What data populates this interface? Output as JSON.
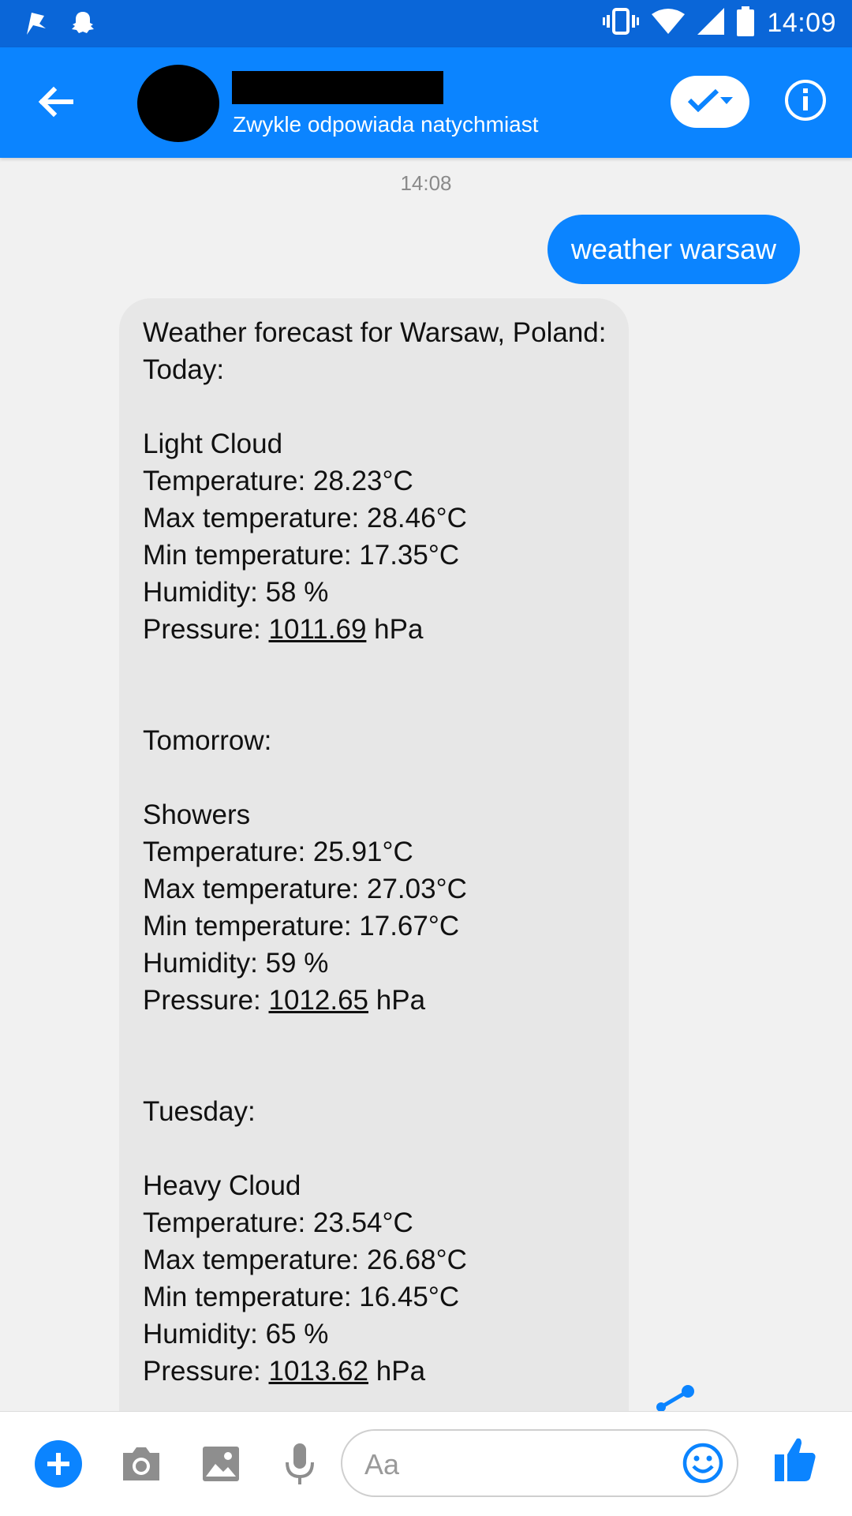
{
  "status_bar": {
    "time": "14:09",
    "icons": [
      "notification-flag-icon",
      "snapchat-icon",
      "vibrate-icon",
      "wifi-icon",
      "signal-icon",
      "battery-icon"
    ]
  },
  "header": {
    "subtitle": "Zwykle odpowiada natychmiast",
    "icons": [
      "back-arrow-icon",
      "check-icon",
      "chevron-down-icon",
      "info-icon"
    ]
  },
  "chat": {
    "timestamp": "14:08",
    "outgoing_message": "weather warsaw",
    "incoming_message_lines": [
      "Weather forecast for Warsaw, Poland:",
      "Today:",
      "",
      "Light Cloud",
      "Temperature: 28.23°C",
      "Max temperature: 28.46°C",
      "Min temperature: 17.35°C",
      "Humidity: 58 %",
      "Pressure: 1011.69 hPa",
      "",
      "",
      "Tomorrow:",
      "",
      "Showers",
      "Temperature: 25.91°C",
      "Max temperature: 27.03°C",
      "Min temperature: 17.67°C",
      "Humidity: 59 %",
      "Pressure: 1012.65 hPa",
      "",
      "",
      "Tuesday:",
      "",
      "Heavy Cloud",
      "Temperature: 23.54°C",
      "Max temperature: 26.68°C",
      "Min temperature: 16.45°C",
      "Humidity: 65 %",
      "Pressure: 1013.62 hPa"
    ]
  },
  "composer": {
    "placeholder": "Aa",
    "icons": [
      "plus-icon",
      "camera-icon",
      "image-icon",
      "microphone-icon",
      "emoji-icon",
      "thumbs-up-icon"
    ]
  },
  "colors": {
    "status_bar": "#0a66d8",
    "app_bar": "#0b84ff",
    "outgoing_bubble": "#0b84ff",
    "incoming_bubble": "#e7e7e7",
    "background": "#f1f1f1"
  }
}
